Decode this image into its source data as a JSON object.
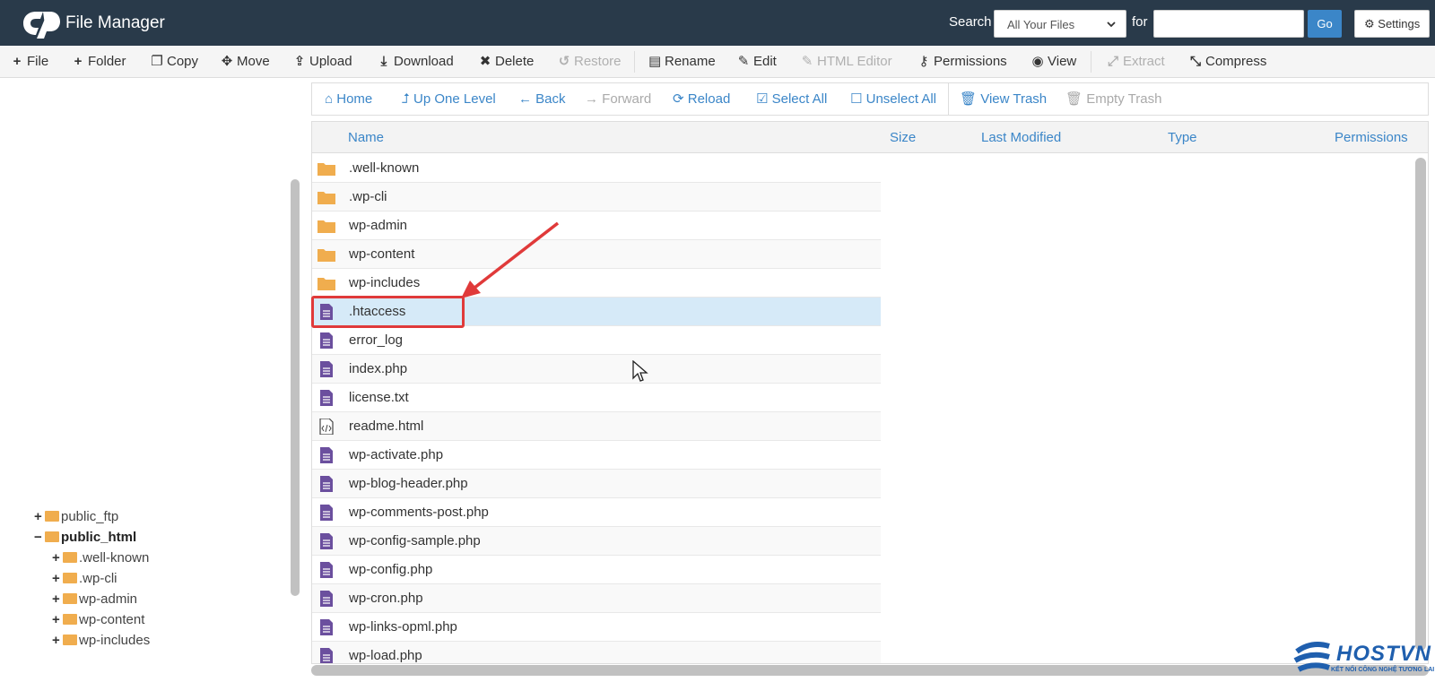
{
  "header": {
    "app_title": "File Manager",
    "search_label": "Search",
    "search_scope": "All Your Files",
    "for_label": "for",
    "search_value": "",
    "go_label": "Go",
    "settings_label": "Settings"
  },
  "toolbar": {
    "file": "File",
    "folder": "Folder",
    "copy": "Copy",
    "move": "Move",
    "upload": "Upload",
    "download": "Download",
    "delete": "Delete",
    "restore": "Restore",
    "rename": "Rename",
    "edit": "Edit",
    "html_editor": "HTML Editor",
    "permissions": "Permissions",
    "view": "View",
    "extract": "Extract",
    "compress": "Compress"
  },
  "nav": {
    "home": "Home",
    "up_one_level": "Up One Level",
    "back": "Back",
    "forward": "Forward",
    "reload": "Reload",
    "select_all": "Select All",
    "unselect_all": "Unselect All",
    "view_trash": "View Trash",
    "empty_trash": "Empty Trash"
  },
  "table": {
    "columns": [
      "Name",
      "Size",
      "Last Modified",
      "Type",
      "Permissions"
    ],
    "rows": [
      {
        "name": ".well-known",
        "kind": "folder"
      },
      {
        "name": ".wp-cli",
        "kind": "folder"
      },
      {
        "name": "wp-admin",
        "kind": "folder"
      },
      {
        "name": "wp-content",
        "kind": "folder"
      },
      {
        "name": "wp-includes",
        "kind": "folder"
      },
      {
        "name": ".htaccess",
        "kind": "text",
        "selected": true
      },
      {
        "name": "error_log",
        "kind": "text"
      },
      {
        "name": "index.php",
        "kind": "text"
      },
      {
        "name": "license.txt",
        "kind": "text"
      },
      {
        "name": "readme.html",
        "kind": "html"
      },
      {
        "name": "wp-activate.php",
        "kind": "text"
      },
      {
        "name": "wp-blog-header.php",
        "kind": "text"
      },
      {
        "name": "wp-comments-post.php",
        "kind": "text"
      },
      {
        "name": "wp-config-sample.php",
        "kind": "text"
      },
      {
        "name": "wp-config.php",
        "kind": "text"
      },
      {
        "name": "wp-cron.php",
        "kind": "text"
      },
      {
        "name": "wp-links-opml.php",
        "kind": "text"
      },
      {
        "name": "wp-load.php",
        "kind": "text"
      }
    ]
  },
  "tree": {
    "public_ftp": "public_ftp",
    "public_html": "public_html",
    "well_known": ".well-known",
    "wp_cli": ".wp-cli",
    "wp_admin": "wp-admin",
    "wp_content": "wp-content",
    "wp_includes": "wp-includes"
  },
  "brand": {
    "name": "HOSTVN",
    "tagline": "KẾT NỐI CÔNG NGHỆ TƯƠNG LAI"
  },
  "colors": {
    "header_bg": "#293a4a",
    "accent_blue": "#3b86c8",
    "folder": "#f0ad4e",
    "file_icon": "#6b4f9e",
    "selected_row": "#d6eaf8",
    "annotation_red": "#e03a3a"
  }
}
